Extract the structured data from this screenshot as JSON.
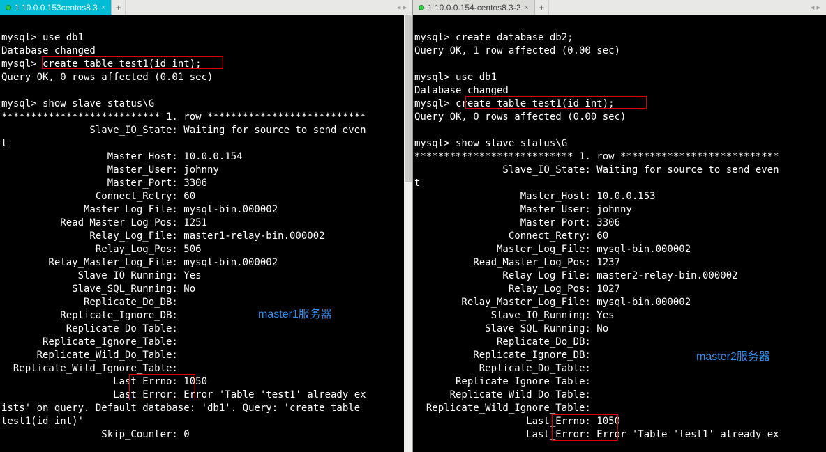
{
  "left": {
    "tab": {
      "label": "1 10.0.0.153centos8.3",
      "active": true,
      "close": "×"
    },
    "add": "+",
    "nav": "◂  ▸",
    "lines": [
      "",
      "mysql> use db1",
      "Database changed",
      "mysql> create table test1(id int);",
      "Query OK, 0 rows affected (0.01 sec)",
      "",
      "mysql> show slave status\\G",
      "*************************** 1. row ***************************",
      "               Slave_IO_State: Waiting for source to send even",
      "t",
      "                  Master_Host: 10.0.0.154",
      "                  Master_User: johnny",
      "                  Master_Port: 3306",
      "                Connect_Retry: 60",
      "              Master_Log_File: mysql-bin.000002",
      "          Read_Master_Log_Pos: 1251",
      "               Relay_Log_File: master1-relay-bin.000002",
      "                Relay_Log_Pos: 506",
      "        Relay_Master_Log_File: mysql-bin.000002",
      "             Slave_IO_Running: Yes",
      "            Slave_SQL_Running: No",
      "              Replicate_Do_DB:",
      "          Replicate_Ignore_DB:",
      "           Replicate_Do_Table:",
      "       Replicate_Ignore_Table:",
      "      Replicate_Wild_Do_Table:",
      "  Replicate_Wild_Ignore_Table:",
      "                   Last_Errno: 1050",
      "                   Last_Error: Error 'Table 'test1' already ex",
      "ists' on query. Default database: 'db1'. Query: 'create table ",
      "test1(id int)'",
      "                 Skip_Counter: 0"
    ],
    "annot": "master1服务器"
  },
  "right": {
    "tab": {
      "label": "1 10.0.0.154-centos8.3-2",
      "active": false,
      "close": "×"
    },
    "add": "+",
    "nav": "◂  ▸",
    "lines": [
      "",
      "mysql> create database db2;",
      "Query OK, 1 row affected (0.00 sec)",
      "",
      "mysql> use db1",
      "Database changed",
      "mysql> create table test1(id int);",
      "Query OK, 0 rows affected (0.00 sec)",
      "",
      "mysql> show slave status\\G",
      "*************************** 1. row ***************************",
      "               Slave_IO_State: Waiting for source to send even",
      "t",
      "                  Master_Host: 10.0.0.153",
      "                  Master_User: johnny",
      "                  Master_Port: 3306",
      "                Connect_Retry: 60",
      "              Master_Log_File: mysql-bin.000002",
      "          Read_Master_Log_Pos: 1237",
      "               Relay_Log_File: master2-relay-bin.000002",
      "                Relay_Log_Pos: 1027",
      "        Relay_Master_Log_File: mysql-bin.000002",
      "             Slave_IO_Running: Yes",
      "            Slave_SQL_Running: No",
      "              Replicate_Do_DB:",
      "          Replicate_Ignore_DB:",
      "           Replicate_Do_Table:",
      "       Replicate_Ignore_Table:",
      "      Replicate_Wild_Do_Table:",
      "  Replicate_Wild_Ignore_Table:",
      "                   Last_Errno: 1050",
      "                   Last_Error: Error 'Table 'test1' already ex"
    ],
    "annot": "master2服务器",
    "watermark": ""
  }
}
